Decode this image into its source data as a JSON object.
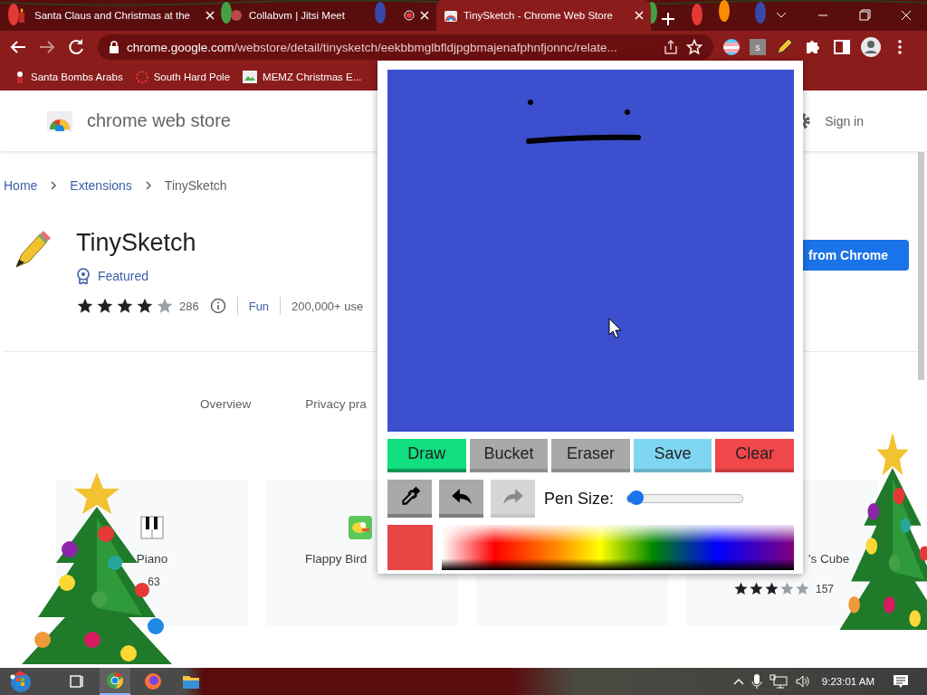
{
  "browser": {
    "tabs": [
      {
        "title": "Santa Claus and Christmas at the",
        "selected": false,
        "recording": false
      },
      {
        "title": "Collabvm | Jitsi Meet",
        "selected": false,
        "recording": true
      },
      {
        "title": "TinySketch - Chrome Web Store",
        "selected": true,
        "recording": false
      }
    ],
    "address": {
      "domain": "chrome.google.com",
      "path": "/webstore/detail/tinysketch/eekbbmglbfldjpgbmajenafphnfjonnc/relate..."
    },
    "extension_badge": "s",
    "bookmarks": [
      "Santa Bombs Arabs",
      "South Hard Pole",
      "MEMZ Christmas E..."
    ]
  },
  "store": {
    "logo_text": "chrome web store",
    "sign_in": "Sign in",
    "breadcrumb": [
      "Home",
      "Extensions",
      "TinySketch"
    ],
    "title": "TinySketch",
    "featured": "Featured",
    "stars": 4,
    "rating_count": "286",
    "category": "Fun",
    "users": "200,000+ use",
    "install_button": "from Chrome",
    "tabs": [
      "Overview",
      "Privacy pra"
    ],
    "cards": [
      {
        "kind": "piano",
        "name": "Piano",
        "rating_count": "63"
      },
      {
        "kind": "bird",
        "name": "Flappy Bird"
      },
      {
        "kind": "hidden"
      },
      {
        "kind": "cube",
        "name": "'s Cube",
        "stars": 3,
        "rating_count": "157"
      }
    ]
  },
  "popup": {
    "tools": [
      {
        "label": "Draw",
        "kind": "tool",
        "selected": true
      },
      {
        "label": "Bucket",
        "kind": "tool",
        "selected": false
      },
      {
        "label": "Eraser",
        "kind": "tool",
        "selected": false
      },
      {
        "label": "Save",
        "kind": "save",
        "selected": false
      },
      {
        "label": "Clear",
        "kind": "clear",
        "selected": false
      }
    ],
    "icon_buttons": [
      {
        "kind": "eyedropper",
        "disabled": false
      },
      {
        "kind": "undo",
        "disabled": false
      },
      {
        "kind": "redo",
        "disabled": true
      }
    ],
    "pen_size": {
      "label": "Pen Size:",
      "level": 0.06
    },
    "color": "#e84545"
  },
  "taskbar": {
    "clock": "9:23:01 AM"
  }
}
